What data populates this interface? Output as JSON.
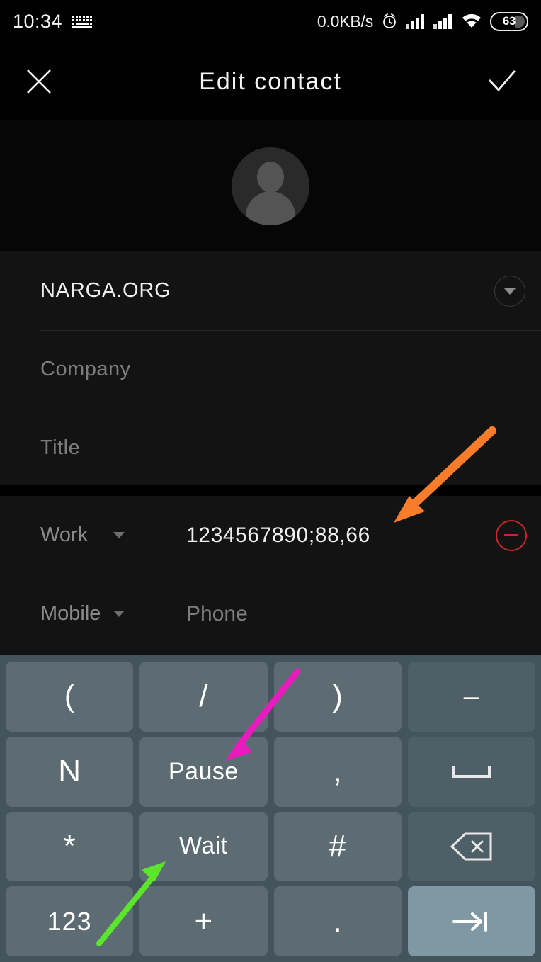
{
  "status_bar": {
    "time": "10:34",
    "keyboard_icon": "keyboard-icon",
    "network_speed": "0.0KB/s",
    "alarm_icon": "alarm-icon",
    "signal_icon_1": "signal-bars-icon",
    "signal_icon_2": "signal-bars-icon",
    "wifi_icon": "wifi-icon",
    "battery_level": "63"
  },
  "app_bar": {
    "close_icon": "close-icon",
    "title": "Edit contact",
    "done_icon": "check-icon"
  },
  "avatar": {
    "name": "contact-avatar-placeholder"
  },
  "contact_fields": [
    {
      "name": "display-name",
      "value": "NARGA.ORG",
      "placeholder": "",
      "has_expand": true
    },
    {
      "name": "company",
      "value": "",
      "placeholder": "Company",
      "has_expand": false
    },
    {
      "name": "title",
      "value": "",
      "placeholder": "Title",
      "has_expand": false
    }
  ],
  "phone_rows": [
    {
      "type": "Work",
      "value": "1234567890;88,66",
      "placeholder": "",
      "has_remove": true
    },
    {
      "type": "Mobile",
      "value": "",
      "placeholder": "Phone",
      "has_remove": false
    }
  ],
  "keyboard": {
    "rows": [
      [
        {
          "label": "(",
          "kind": "glyph",
          "style": "normal",
          "name": "key-open-paren"
        },
        {
          "label": "/",
          "kind": "glyph",
          "style": "normal",
          "name": "key-slash"
        },
        {
          "label": ")",
          "kind": "glyph",
          "style": "normal",
          "name": "key-close-paren"
        },
        {
          "label": "–",
          "kind": "glyph",
          "style": "dim",
          "name": "key-dash"
        }
      ],
      [
        {
          "label": "N",
          "kind": "glyph",
          "style": "normal",
          "name": "key-n"
        },
        {
          "label": "Pause",
          "kind": "word",
          "style": "normal",
          "name": "key-pause"
        },
        {
          "label": ",",
          "kind": "glyph",
          "style": "normal",
          "name": "key-comma"
        },
        {
          "label": "⌴",
          "kind": "space",
          "style": "dim",
          "name": "key-space"
        }
      ],
      [
        {
          "label": "*",
          "kind": "glyph",
          "style": "normal",
          "name": "key-asterisk"
        },
        {
          "label": "Wait",
          "kind": "word",
          "style": "normal",
          "name": "key-wait"
        },
        {
          "label": "#",
          "kind": "glyph",
          "style": "normal",
          "name": "key-hash"
        },
        {
          "label": "⌫",
          "kind": "backspace",
          "style": "dim",
          "name": "key-backspace"
        }
      ],
      [
        {
          "label": "123",
          "kind": "num",
          "style": "normal",
          "name": "key-123"
        },
        {
          "label": "+",
          "kind": "glyph",
          "style": "normal",
          "name": "key-plus"
        },
        {
          "label": ".",
          "kind": "glyph",
          "style": "normal",
          "name": "key-period"
        },
        {
          "label": "→|",
          "kind": "tab",
          "style": "accent",
          "name": "key-next"
        }
      ]
    ]
  },
  "annotations": [
    {
      "name": "orange-arrow-phone-value",
      "color": "#F97C2B"
    },
    {
      "name": "magenta-arrow-pause-key",
      "color": "#E81BBF"
    },
    {
      "name": "green-arrow-wait-key",
      "color": "#5BE62B"
    }
  ],
  "colors": {
    "screen_background": "#0d0d0d",
    "section_background": "#131313",
    "keyboard_background": "#44545c",
    "key_background": "#5d6c73",
    "key_accent": "#8097a4",
    "remove_red": "#c62828"
  }
}
